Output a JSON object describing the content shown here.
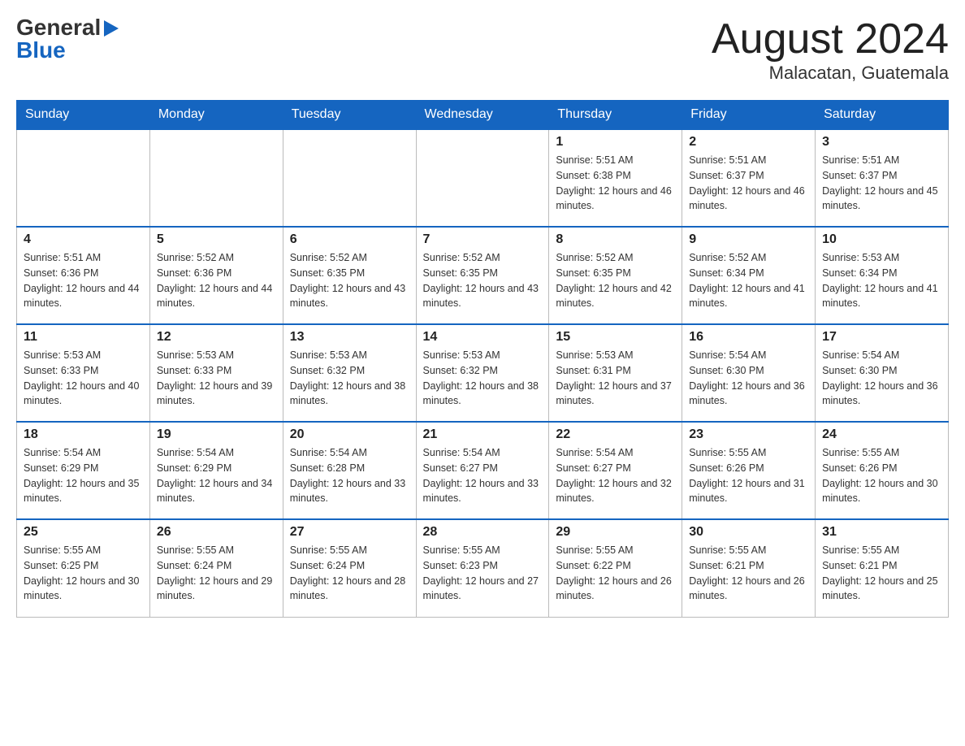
{
  "header": {
    "logo_general": "General",
    "logo_blue": "Blue",
    "month_title": "August 2024",
    "location": "Malacatan, Guatemala"
  },
  "weekdays": [
    "Sunday",
    "Monday",
    "Tuesday",
    "Wednesday",
    "Thursday",
    "Friday",
    "Saturday"
  ],
  "weeks": [
    [
      {
        "day": "",
        "info": ""
      },
      {
        "day": "",
        "info": ""
      },
      {
        "day": "",
        "info": ""
      },
      {
        "day": "",
        "info": ""
      },
      {
        "day": "1",
        "info": "Sunrise: 5:51 AM\nSunset: 6:38 PM\nDaylight: 12 hours and 46 minutes."
      },
      {
        "day": "2",
        "info": "Sunrise: 5:51 AM\nSunset: 6:37 PM\nDaylight: 12 hours and 46 minutes."
      },
      {
        "day": "3",
        "info": "Sunrise: 5:51 AM\nSunset: 6:37 PM\nDaylight: 12 hours and 45 minutes."
      }
    ],
    [
      {
        "day": "4",
        "info": "Sunrise: 5:51 AM\nSunset: 6:36 PM\nDaylight: 12 hours and 44 minutes."
      },
      {
        "day": "5",
        "info": "Sunrise: 5:52 AM\nSunset: 6:36 PM\nDaylight: 12 hours and 44 minutes."
      },
      {
        "day": "6",
        "info": "Sunrise: 5:52 AM\nSunset: 6:35 PM\nDaylight: 12 hours and 43 minutes."
      },
      {
        "day": "7",
        "info": "Sunrise: 5:52 AM\nSunset: 6:35 PM\nDaylight: 12 hours and 43 minutes."
      },
      {
        "day": "8",
        "info": "Sunrise: 5:52 AM\nSunset: 6:35 PM\nDaylight: 12 hours and 42 minutes."
      },
      {
        "day": "9",
        "info": "Sunrise: 5:52 AM\nSunset: 6:34 PM\nDaylight: 12 hours and 41 minutes."
      },
      {
        "day": "10",
        "info": "Sunrise: 5:53 AM\nSunset: 6:34 PM\nDaylight: 12 hours and 41 minutes."
      }
    ],
    [
      {
        "day": "11",
        "info": "Sunrise: 5:53 AM\nSunset: 6:33 PM\nDaylight: 12 hours and 40 minutes."
      },
      {
        "day": "12",
        "info": "Sunrise: 5:53 AM\nSunset: 6:33 PM\nDaylight: 12 hours and 39 minutes."
      },
      {
        "day": "13",
        "info": "Sunrise: 5:53 AM\nSunset: 6:32 PM\nDaylight: 12 hours and 38 minutes."
      },
      {
        "day": "14",
        "info": "Sunrise: 5:53 AM\nSunset: 6:32 PM\nDaylight: 12 hours and 38 minutes."
      },
      {
        "day": "15",
        "info": "Sunrise: 5:53 AM\nSunset: 6:31 PM\nDaylight: 12 hours and 37 minutes."
      },
      {
        "day": "16",
        "info": "Sunrise: 5:54 AM\nSunset: 6:30 PM\nDaylight: 12 hours and 36 minutes."
      },
      {
        "day": "17",
        "info": "Sunrise: 5:54 AM\nSunset: 6:30 PM\nDaylight: 12 hours and 36 minutes."
      }
    ],
    [
      {
        "day": "18",
        "info": "Sunrise: 5:54 AM\nSunset: 6:29 PM\nDaylight: 12 hours and 35 minutes."
      },
      {
        "day": "19",
        "info": "Sunrise: 5:54 AM\nSunset: 6:29 PM\nDaylight: 12 hours and 34 minutes."
      },
      {
        "day": "20",
        "info": "Sunrise: 5:54 AM\nSunset: 6:28 PM\nDaylight: 12 hours and 33 minutes."
      },
      {
        "day": "21",
        "info": "Sunrise: 5:54 AM\nSunset: 6:27 PM\nDaylight: 12 hours and 33 minutes."
      },
      {
        "day": "22",
        "info": "Sunrise: 5:54 AM\nSunset: 6:27 PM\nDaylight: 12 hours and 32 minutes."
      },
      {
        "day": "23",
        "info": "Sunrise: 5:55 AM\nSunset: 6:26 PM\nDaylight: 12 hours and 31 minutes."
      },
      {
        "day": "24",
        "info": "Sunrise: 5:55 AM\nSunset: 6:26 PM\nDaylight: 12 hours and 30 minutes."
      }
    ],
    [
      {
        "day": "25",
        "info": "Sunrise: 5:55 AM\nSunset: 6:25 PM\nDaylight: 12 hours and 30 minutes."
      },
      {
        "day": "26",
        "info": "Sunrise: 5:55 AM\nSunset: 6:24 PM\nDaylight: 12 hours and 29 minutes."
      },
      {
        "day": "27",
        "info": "Sunrise: 5:55 AM\nSunset: 6:24 PM\nDaylight: 12 hours and 28 minutes."
      },
      {
        "day": "28",
        "info": "Sunrise: 5:55 AM\nSunset: 6:23 PM\nDaylight: 12 hours and 27 minutes."
      },
      {
        "day": "29",
        "info": "Sunrise: 5:55 AM\nSunset: 6:22 PM\nDaylight: 12 hours and 26 minutes."
      },
      {
        "day": "30",
        "info": "Sunrise: 5:55 AM\nSunset: 6:21 PM\nDaylight: 12 hours and 26 minutes."
      },
      {
        "day": "31",
        "info": "Sunrise: 5:55 AM\nSunset: 6:21 PM\nDaylight: 12 hours and 25 minutes."
      }
    ]
  ]
}
